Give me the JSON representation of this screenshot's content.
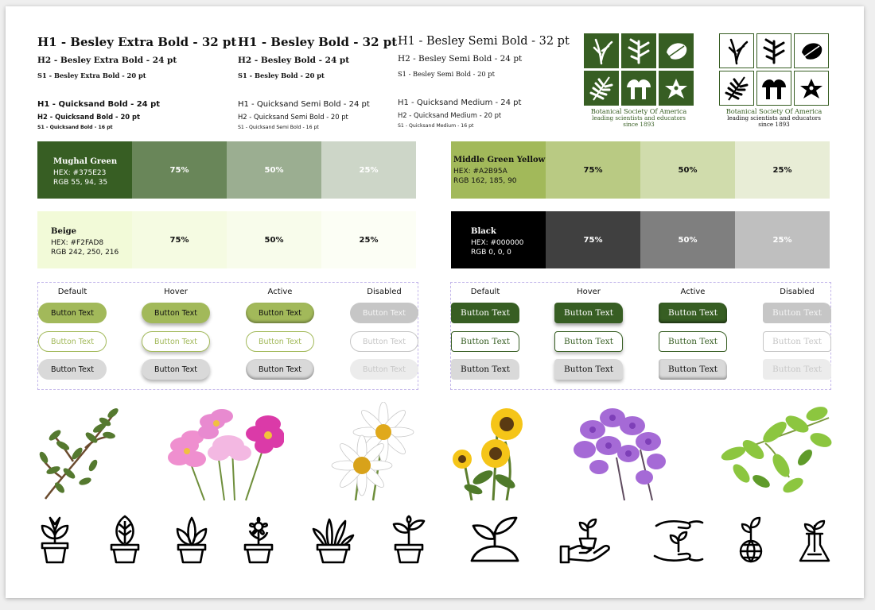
{
  "typography": [
    {
      "h1": "H1 - Besley Extra Bold - 32 pt",
      "h2": "H2 - Besley Extra Bold - 24 pt",
      "s1": "S1 - Besley Extra Bold - 20 pt",
      "q1": "H1 - Quicksand Bold - 24 pt",
      "q2": "H2 - Quicksand Bold - 20 pt",
      "q3": "S1 - Quicksand Bold - 16 pt"
    },
    {
      "h1": "H1 - Besley Bold - 32 pt",
      "h2": "H2 - Besley Bold - 24 pt",
      "s1": "S1 - Besley Bold - 20 pt",
      "q1": "H1 - Quicksand Semi Bold - 24 pt",
      "q2": "H2 - Quicksand Semi Bold - 20 pt",
      "q3": "S1 - Quicksand Semi Bold - 16 pt"
    },
    {
      "h1": "H1 - Besley Semi Bold - 32 pt",
      "h2": "H2 - Besley Semi Bold - 24 pt",
      "s1": "S1 - Besley Semi Bold - 20 pt",
      "q1": "H1 - Quicksand Medium - 24 pt",
      "q2": "H2 - Quicksand Medium - 20 pt",
      "q3": "S1 - Quicksand Medium - 16 pt"
    }
  ],
  "logo": {
    "title": "Botanical Society Of America",
    "line1": "leading scientists and educators",
    "line2": "since 1893"
  },
  "palette": [
    {
      "name": "Mughal Green",
      "hex": "HEX: #375E23",
      "rgb": "RGB 55, 94, 35",
      "color": "#375E23",
      "tints": [
        {
          "label": "75%",
          "color": "#698659"
        },
        {
          "label": "50%",
          "color": "#9BAE91"
        },
        {
          "label": "25%",
          "color": "#CDD6C8"
        }
      ],
      "text": "#ffffff",
      "tint_text": "#ffffff"
    },
    {
      "name": "Middle Green Yellow",
      "hex": "HEX: #A2B95A",
      "rgb": "RGB 162, 185, 90",
      "color": "#A2B95A",
      "tints": [
        {
          "label": "75%",
          "color": "#B9CA83"
        },
        {
          "label": "50%",
          "color": "#D0DCAC"
        },
        {
          "label": "25%",
          "color": "#E8EDD6"
        }
      ],
      "text": "#111111",
      "tint_text": "#111111"
    },
    {
      "name": "Beige",
      "hex": "HEX: #F2FAD8",
      "rgb": "RGB 242, 250, 216",
      "color": "#F2FAD8",
      "tints": [
        {
          "label": "75%",
          "color": "#F5FBE2"
        },
        {
          "label": "50%",
          "color": "#F8FCEB"
        },
        {
          "label": "25%",
          "color": "#FCFEF5"
        }
      ],
      "text": "#111111",
      "tint_text": "#111111"
    },
    {
      "name": "Black",
      "hex": "HEX: #000000",
      "rgb": "RGB 0, 0, 0",
      "color": "#000000",
      "tints": [
        {
          "label": "75%",
          "color": "#404040"
        },
        {
          "label": "50%",
          "color": "#7f7f7f"
        },
        {
          "label": "25%",
          "color": "#bfbfbf"
        }
      ],
      "text": "#ffffff",
      "tint_text": "#ffffff"
    }
  ],
  "button_states": [
    "Default",
    "Hover",
    "Active",
    "Disabled"
  ],
  "button_label": "Button Text",
  "photos": [
    "branch",
    "pink-cosmos",
    "daisies",
    "sunflowers",
    "purple-orchid",
    "green-leaves"
  ],
  "icons": [
    "potted-plant-icon",
    "potted-leaf-icon",
    "potted-sprout-icon",
    "potted-flower-icon",
    "potted-grass-icon",
    "potted-seedling-icon",
    "sprout-soil-icon",
    "hand-plant-pot-icon",
    "hands-protect-plant-icon",
    "globe-sprout-icon",
    "flask-sprout-icon"
  ]
}
